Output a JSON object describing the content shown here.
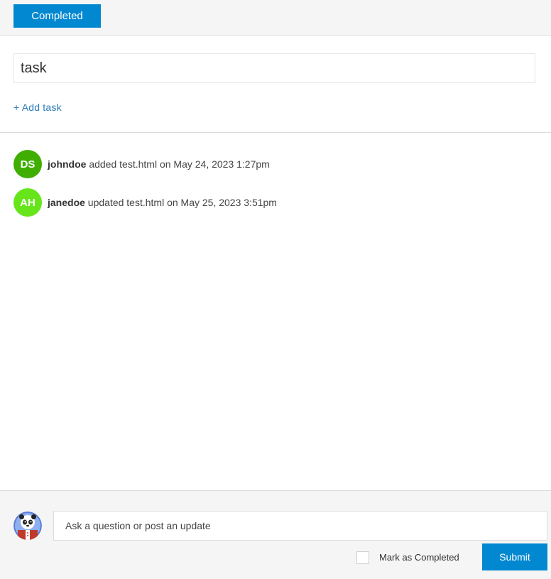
{
  "header": {
    "completed_label": "Completed",
    "button_color": "#0288d1"
  },
  "task": {
    "title_value": "task",
    "add_task_label": "+ Add task"
  },
  "activity": [
    {
      "initials": "DS",
      "avatar_color": "#3fae00",
      "user": "johndoe",
      "action": "added test.html on May 24, 2023 1:27pm"
    },
    {
      "initials": "AH",
      "avatar_color": "#66e61a",
      "user": "janedoe",
      "action": "updated test.html on May 25, 2023 3:51pm"
    }
  ],
  "composer": {
    "avatar_icon": "panda-avatar-icon",
    "placeholder": "Ask a question or post an update",
    "mark_completed_label": "Mark as Completed",
    "mark_completed_checked": false,
    "submit_label": "Submit"
  }
}
